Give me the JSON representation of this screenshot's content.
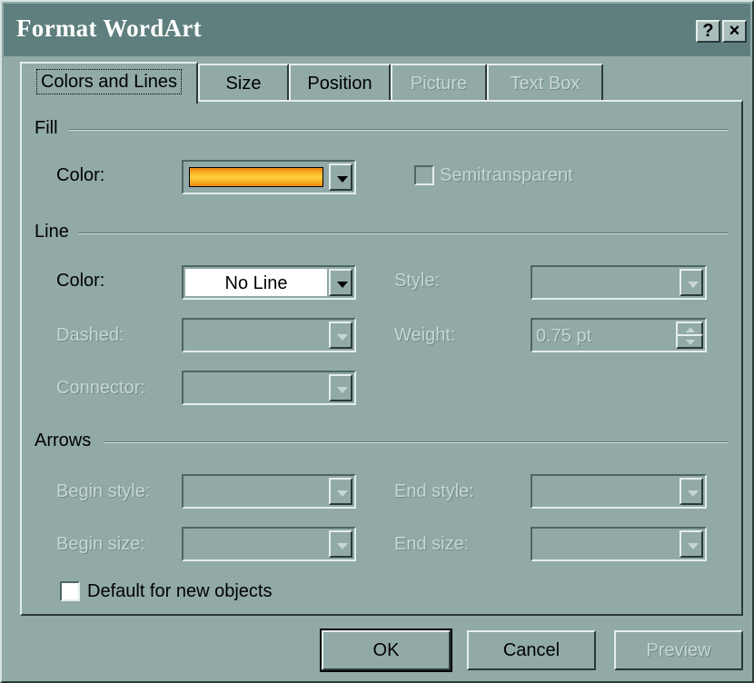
{
  "window": {
    "title": "Format WordArt",
    "help_label": "?",
    "close_label": "×"
  },
  "tabs": [
    {
      "label": "Colors and Lines",
      "state": "active"
    },
    {
      "label": "Size",
      "state": "enabled"
    },
    {
      "label": "Position",
      "state": "enabled"
    },
    {
      "label": "Picture",
      "state": "disabled"
    },
    {
      "label": "Text Box",
      "state": "disabled"
    }
  ],
  "fill": {
    "section_label": "Fill",
    "color_label": "Color:",
    "color_value": "orange gradient",
    "semitransparent_label": "Semitransparent",
    "semitransparent_checked": false
  },
  "line": {
    "section_label": "Line",
    "color_label": "Color:",
    "color_value": "No Line",
    "style_label": "Style:",
    "dashed_label": "Dashed:",
    "weight_label": "Weight:",
    "weight_value": "0.75 pt",
    "connector_label": "Connector:"
  },
  "arrows": {
    "section_label": "Arrows",
    "begin_style_label": "Begin style:",
    "end_style_label": "End style:",
    "begin_size_label": "Begin size:",
    "end_size_label": "End size:"
  },
  "default_checkbox": {
    "label": "Default for new objects",
    "checked": false
  },
  "buttons": {
    "ok": "OK",
    "cancel": "Cancel",
    "preview": "Preview"
  },
  "colors": {
    "dialog_bg": "#91aaa7",
    "titlebar_bg": "#5e7f7d",
    "fill_gradient_edge": "#f08a10",
    "fill_gradient_center": "#ffd23a"
  }
}
